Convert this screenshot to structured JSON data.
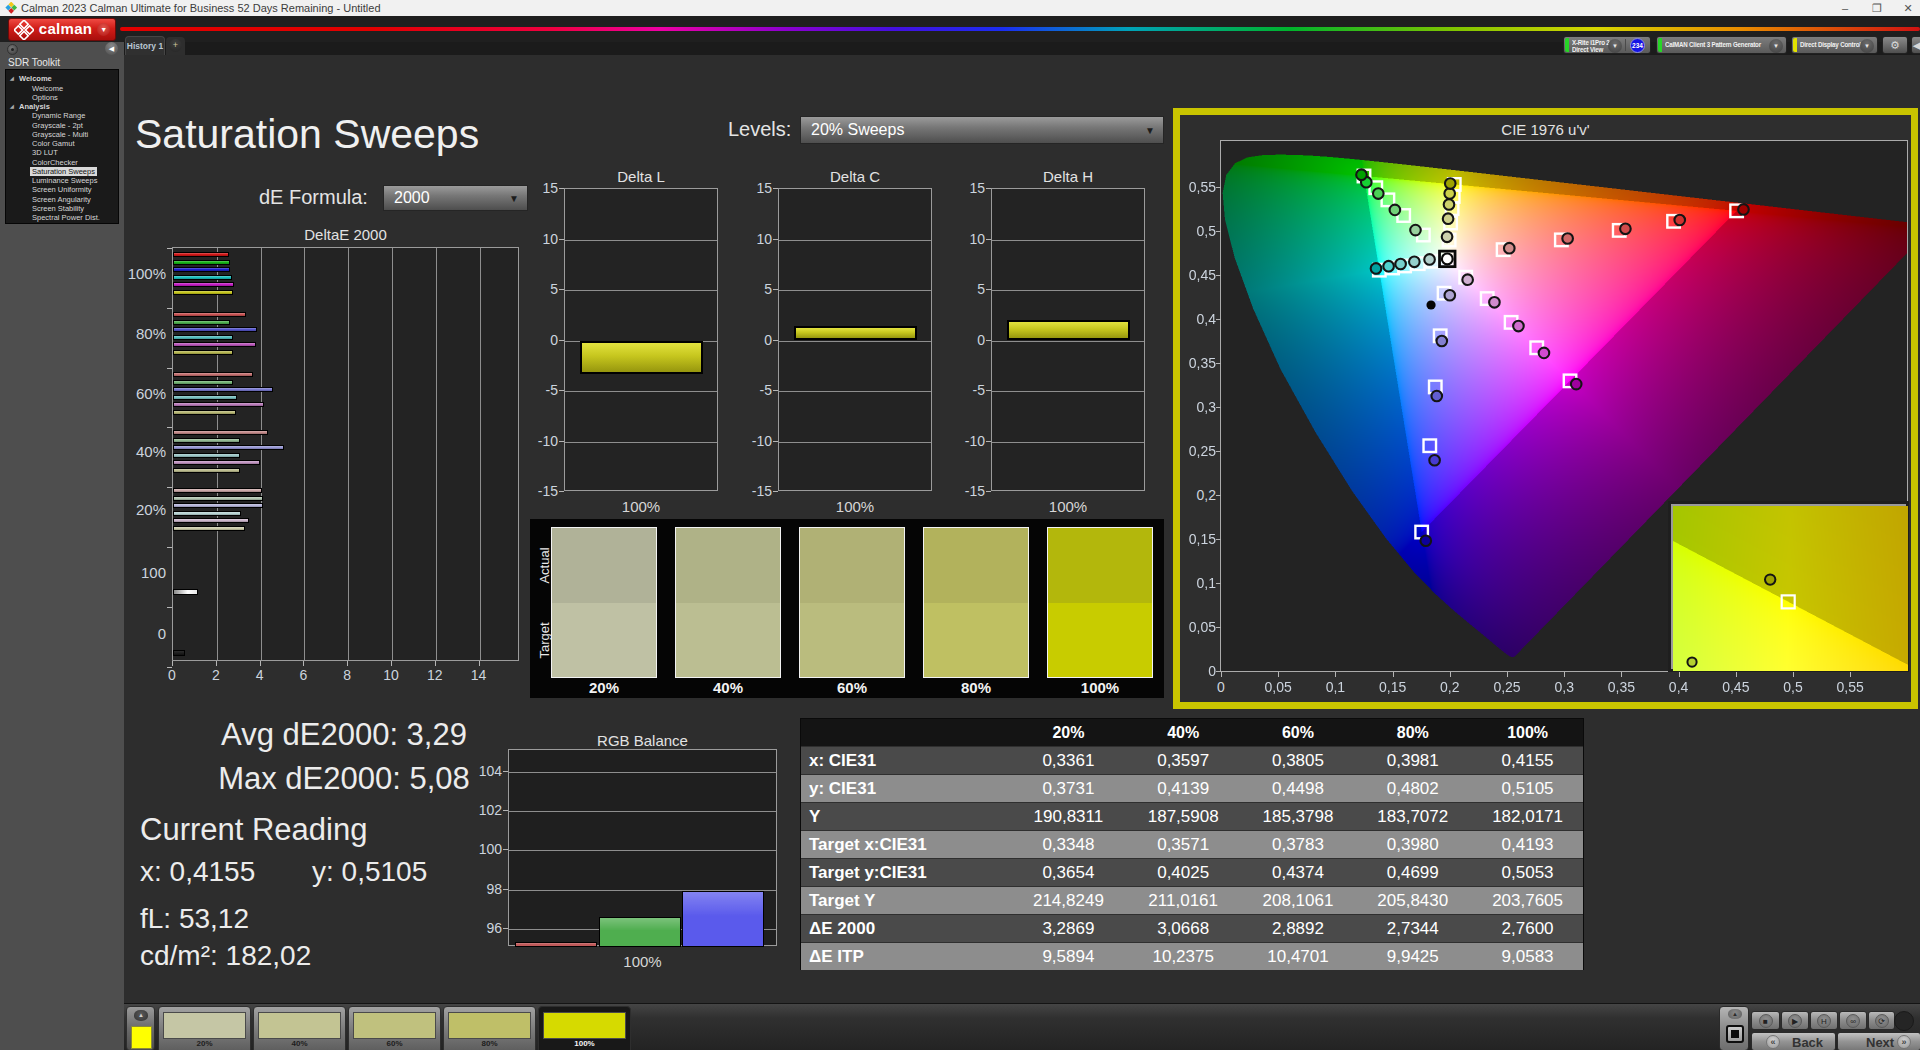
{
  "window": {
    "title": "Calman 2023 Calman Ultimate for Business 52 Days Remaining  - Untitled",
    "minimize": "–",
    "maximize": "❐",
    "close": "✕"
  },
  "menubar": {
    "logo_text": "calman",
    "accent_red": "#d01d18"
  },
  "tabs": {
    "active_tab": "History 1",
    "add_tab": "+"
  },
  "devices": {
    "meter": {
      "line1": "X-Rite i1Pro 2",
      "line2": "Direct View",
      "status_color": "#27d427",
      "badge": "234"
    },
    "source": {
      "line1": "CalMAN Client 3 Pattern Generator",
      "line2": "",
      "status_color": "#27d427"
    },
    "display": {
      "line1": "Direct Display Control",
      "line2": "",
      "status_color": "#e3e300"
    }
  },
  "sidebar": {
    "title": "SDR Toolkit",
    "selected": "Saturation Sweeps",
    "sections": [
      {
        "label": "Welcome",
        "children": [
          "Welcome",
          "Options"
        ]
      },
      {
        "label": "Analysis",
        "children": [
          "Dynamic Range",
          "Grayscale - 2pt",
          "Grayscale - Multi",
          "Color Gamut",
          "3D LUT",
          "ColorChecker",
          "Saturation Sweeps",
          "Luminance Sweeps",
          "Screen Uniformity",
          "Screen Angularity",
          "Screen Stability",
          "Spectral Power Dist."
        ]
      }
    ]
  },
  "page": {
    "title": "Saturation Sweeps",
    "levels_label": "Levels:",
    "levels_value": "20% Sweeps",
    "de_formula_label": "dE Formula:",
    "de_formula_value": "2000"
  },
  "readings": {
    "avg_label": "Avg dE2000:",
    "avg_value": "3,29",
    "max_label": "Max dE2000:",
    "max_value": "5,08",
    "current_title": "Current Reading",
    "x_label": "x:",
    "x_value": "0,4155",
    "y_label": "y:",
    "y_value": "0,5105",
    "fl_label": "fL:",
    "fl_value": "53,12",
    "cd_label": "cd/m²:",
    "cd_value": "182,02"
  },
  "chart_data": [
    {
      "id": "deltae2000",
      "type": "bar",
      "orientation": "horizontal",
      "title": "DeltaE 2000",
      "xticks": [
        0,
        2,
        4,
        6,
        8,
        10,
        12,
        14
      ],
      "xlim": [
        0,
        15.6
      ],
      "series_names": [
        "Red",
        "Green",
        "Blue",
        "Cyan",
        "Magenta",
        "Yellow"
      ],
      "groups": [
        {
          "label": "100%",
          "values": [
            2.55,
            2.6,
            2.62,
            2.68,
            2.8,
            2.76
          ],
          "colors": [
            "#d01818",
            "#17b317",
            "#2020cc",
            "#1abdbd",
            "#c41ec4",
            "#c3c31c"
          ]
        },
        {
          "label": "80%",
          "values": [
            3.35,
            2.58,
            3.85,
            2.72,
            3.8,
            2.73
          ],
          "colors": [
            "#c75252",
            "#4fae4f",
            "#5656cb",
            "#52bcbc",
            "#bb58bb",
            "#b5b551"
          ]
        },
        {
          "label": "60%",
          "values": [
            3.65,
            2.75,
            4.55,
            2.92,
            4.15,
            2.89
          ],
          "colors": [
            "#c26f6f",
            "#72b172",
            "#7a7ad0",
            "#79c0c0",
            "#b97bb9",
            "#b6b674"
          ]
        },
        {
          "label": "40%",
          "values": [
            4.35,
            3.05,
            5.08,
            3.05,
            3.95,
            3.07
          ],
          "colors": [
            "#c28989",
            "#92b892",
            "#9797d4",
            "#9cc6c6",
            "#c094c0",
            "#bcbc90"
          ]
        },
        {
          "label": "20%",
          "values": [
            4.05,
            4.1,
            4.12,
            3.12,
            3.45,
            3.29
          ],
          "colors": [
            "#c9a8a8",
            "#b1c5b1",
            "#b6b6da",
            "#b7d2d2",
            "#cab5ca",
            "#cbcbaa"
          ]
        },
        {
          "label": "100",
          "values": [
            1.16
          ],
          "colors": [
            "#f2f2f2"
          ]
        },
        {
          "label": "0",
          "values": [
            0.54
          ],
          "colors": [
            "#1c1c1c"
          ]
        }
      ]
    },
    {
      "id": "delta_l",
      "type": "bar",
      "title": "Delta L",
      "categories": [
        "100%"
      ],
      "values": [
        -3.35
      ],
      "ylim": [
        -15,
        15
      ],
      "yticks": [
        15,
        10,
        5,
        0,
        -5,
        -10,
        -15
      ],
      "bar_color": "#c6c61e"
    },
    {
      "id": "delta_c",
      "type": "bar",
      "title": "Delta C",
      "categories": [
        "100%"
      ],
      "values": [
        1.45
      ],
      "ylim": [
        -15,
        15
      ],
      "yticks": [
        15,
        10,
        5,
        0,
        -5,
        -10,
        -15
      ],
      "bar_color": "#c6c61e"
    },
    {
      "id": "delta_h",
      "type": "bar",
      "title": "Delta H",
      "categories": [
        "100%"
      ],
      "values": [
        2.05
      ],
      "ylim": [
        -15,
        15
      ],
      "yticks": [
        15,
        10,
        5,
        0,
        -5,
        -10,
        -15
      ],
      "bar_color": "#c6c61e"
    },
    {
      "id": "rgb_balance",
      "type": "bar",
      "title": "RGB Balance",
      "categories": [
        "100%"
      ],
      "ylim": [
        95.1,
        105.1
      ],
      "yticks": [
        96,
        98,
        100,
        102,
        104
      ],
      "series": [
        {
          "name": "Red",
          "value": 95.35,
          "color": "#c05a5a"
        },
        {
          "name": "Green",
          "value": 96.6,
          "color": "#4fae4f"
        },
        {
          "name": "Blue",
          "value": 97.95,
          "color": "#5a5aec"
        }
      ]
    },
    {
      "id": "cie1976",
      "type": "scatter",
      "title": "CIE 1976 u'v'",
      "xlim": [
        0,
        0.6013
      ],
      "ylim": [
        0,
        0.6045
      ],
      "tick_step": 0.05,
      "tick_max": 0.55,
      "white_point": {
        "target": [
          0.1978,
          0.4683
        ],
        "measured": [
          0.1978,
          0.4683
        ]
      },
      "reference_dot": [
        0.1836,
        0.4159
      ],
      "series": [
        {
          "name": "Green",
          "targets": [
            [
              0.1769,
              0.4954
            ],
            [
              0.1597,
              0.5176
            ],
            [
              0.1459,
              0.5354
            ],
            [
              0.1353,
              0.5492
            ],
            [
              0.125,
              0.5625
            ]
          ],
          "measured": [
            [
              0.17,
              0.501
            ],
            [
              0.152,
              0.524
            ],
            [
              0.1375,
              0.5425
            ],
            [
              0.127,
              0.5555
            ],
            [
              0.1228,
              0.564
            ]
          ]
        },
        {
          "name": "Cyan",
          "targets": [
            [
              0.185,
              0.4656
            ],
            [
              0.1724,
              0.4629
            ],
            [
              0.1605,
              0.4603
            ],
            [
              0.15,
              0.458
            ],
            [
              0.1384,
              0.4555
            ]
          ],
          "measured": [
            [
              0.1823,
              0.4677
            ],
            [
              0.169,
              0.465
            ],
            [
              0.157,
              0.4625
            ],
            [
              0.1465,
              0.46
            ],
            [
              0.1355,
              0.4575
            ]
          ]
        },
        {
          "name": "Yellow",
          "targets": [
            [
              0.1994,
              0.4897
            ],
            [
              0.2007,
              0.5091
            ],
            [
              0.202,
              0.5254
            ],
            [
              0.203,
              0.5392
            ],
            [
              0.2039,
              0.5529
            ]
          ],
          "measured": [
            [
              0.1976,
              0.4934
            ],
            [
              0.1985,
              0.514
            ],
            [
              0.1993,
              0.5301
            ],
            [
              0.1999,
              0.5425
            ],
            [
              0.2004,
              0.5539
            ]
          ]
        },
        {
          "name": "Red",
          "targets": [
            [
              0.2466,
              0.4788
            ],
            [
              0.2975,
              0.4899
            ],
            [
              0.3481,
              0.5007
            ],
            [
              0.3956,
              0.511
            ],
            [
              0.4507,
              0.5229
            ]
          ],
          "measured": [
            [
              0.252,
              0.4805
            ],
            [
              0.303,
              0.4915
            ],
            [
              0.3535,
              0.5025
            ],
            [
              0.401,
              0.5125
            ],
            [
              0.4567,
              0.5245
            ]
          ]
        },
        {
          "name": "Magenta",
          "targets": [
            [
              0.2139,
              0.4475
            ],
            [
              0.2327,
              0.4232
            ],
            [
              0.2536,
              0.3962
            ],
            [
              0.276,
              0.3673
            ],
            [
              0.3051,
              0.3297
            ]
          ],
          "measured": [
            [
              0.2156,
              0.4447
            ],
            [
              0.239,
              0.419
            ],
            [
              0.26,
              0.392
            ],
            [
              0.2823,
              0.3615
            ],
            [
              0.3105,
              0.326
            ]
          ]
        },
        {
          "name": "Blue",
          "targets": [
            [
              0.195,
              0.4293
            ],
            [
              0.1916,
              0.3809
            ],
            [
              0.1873,
              0.3228
            ],
            [
              0.1825,
              0.256
            ],
            [
              0.1754,
              0.1579
            ]
          ],
          "measured": [
            [
              0.2,
              0.427
            ],
            [
              0.193,
              0.375
            ],
            [
              0.1886,
              0.3125
            ],
            [
              0.1867,
              0.2395
            ],
            [
              0.179,
              0.148
            ]
          ]
        }
      ],
      "magnifier": {
        "u_window": [
          0.1815,
          0.2272
        ],
        "v_window": [
          0.5498,
          0.5572
        ],
        "square": [
          0.2039,
          0.5529
        ],
        "circle": [
          0.2004,
          0.5539
        ],
        "circle2": [
          0.1852,
          0.5502
        ]
      }
    }
  ],
  "swatch_compare": {
    "row_labels": [
      "Actual",
      "Target"
    ],
    "columns": [
      {
        "label": "20%",
        "actual": "#b0b298",
        "target": "#bfc1a4"
      },
      {
        "label": "40%",
        "actual": "#afb287",
        "target": "#bbbe92"
      },
      {
        "label": "60%",
        "actual": "#b0b175",
        "target": "#babc7e"
      },
      {
        "label": "80%",
        "actual": "#b2b25c",
        "target": "#bfc062"
      },
      {
        "label": "100%",
        "actual": "#b3b70c",
        "target": "#c8cc00"
      }
    ]
  },
  "data_table": {
    "columns": [
      "20%",
      "40%",
      "60%",
      "80%",
      "100%"
    ],
    "rows": [
      {
        "label": "x: CIE31",
        "values": [
          "0,3361",
          "0,3597",
          "0,3805",
          "0,3981",
          "0,4155"
        ]
      },
      {
        "label": "y: CIE31",
        "values": [
          "0,3731",
          "0,4139",
          "0,4498",
          "0,4802",
          "0,5105"
        ]
      },
      {
        "label": "Y",
        "values": [
          "190,8311",
          "187,5908",
          "185,3798",
          "183,7072",
          "182,0171"
        ]
      },
      {
        "label": "Target x:CIE31",
        "values": [
          "0,3348",
          "0,3571",
          "0,3783",
          "0,3980",
          "0,4193"
        ]
      },
      {
        "label": "Target y:CIE31",
        "values": [
          "0,3654",
          "0,4025",
          "0,4374",
          "0,4699",
          "0,5053"
        ]
      },
      {
        "label": "Target Y",
        "values": [
          "214,8249",
          "211,0161",
          "208,1061",
          "205,8430",
          "203,7605"
        ]
      },
      {
        "label": "ΔE 2000",
        "values": [
          "3,2869",
          "3,0668",
          "2,8892",
          "2,7344",
          "2,7600"
        ]
      },
      {
        "label": "ΔE ITP",
        "values": [
          "9,5894",
          "10,2375",
          "10,4701",
          "9,9425",
          "9,0583"
        ]
      }
    ]
  },
  "pattern_bar": {
    "quick_swatch": "#ffff00",
    "buttons": [
      {
        "label": "20%",
        "color": "#c5c6a5",
        "selected": false
      },
      {
        "label": "40%",
        "color": "#c3c493",
        "selected": false
      },
      {
        "label": "60%",
        "color": "#c0c17e",
        "selected": false
      },
      {
        "label": "80%",
        "color": "#bfbf68",
        "selected": false
      },
      {
        "label": "100%",
        "color": "#d6da00",
        "selected": true
      }
    ]
  },
  "transport": {
    "stop": "■",
    "play": "▶",
    "pattern_window": "H",
    "loop": "∞",
    "refresh": "⟳",
    "back_label": "Back",
    "next_label": "Next",
    "back_icon": "«",
    "next_icon": "»"
  }
}
